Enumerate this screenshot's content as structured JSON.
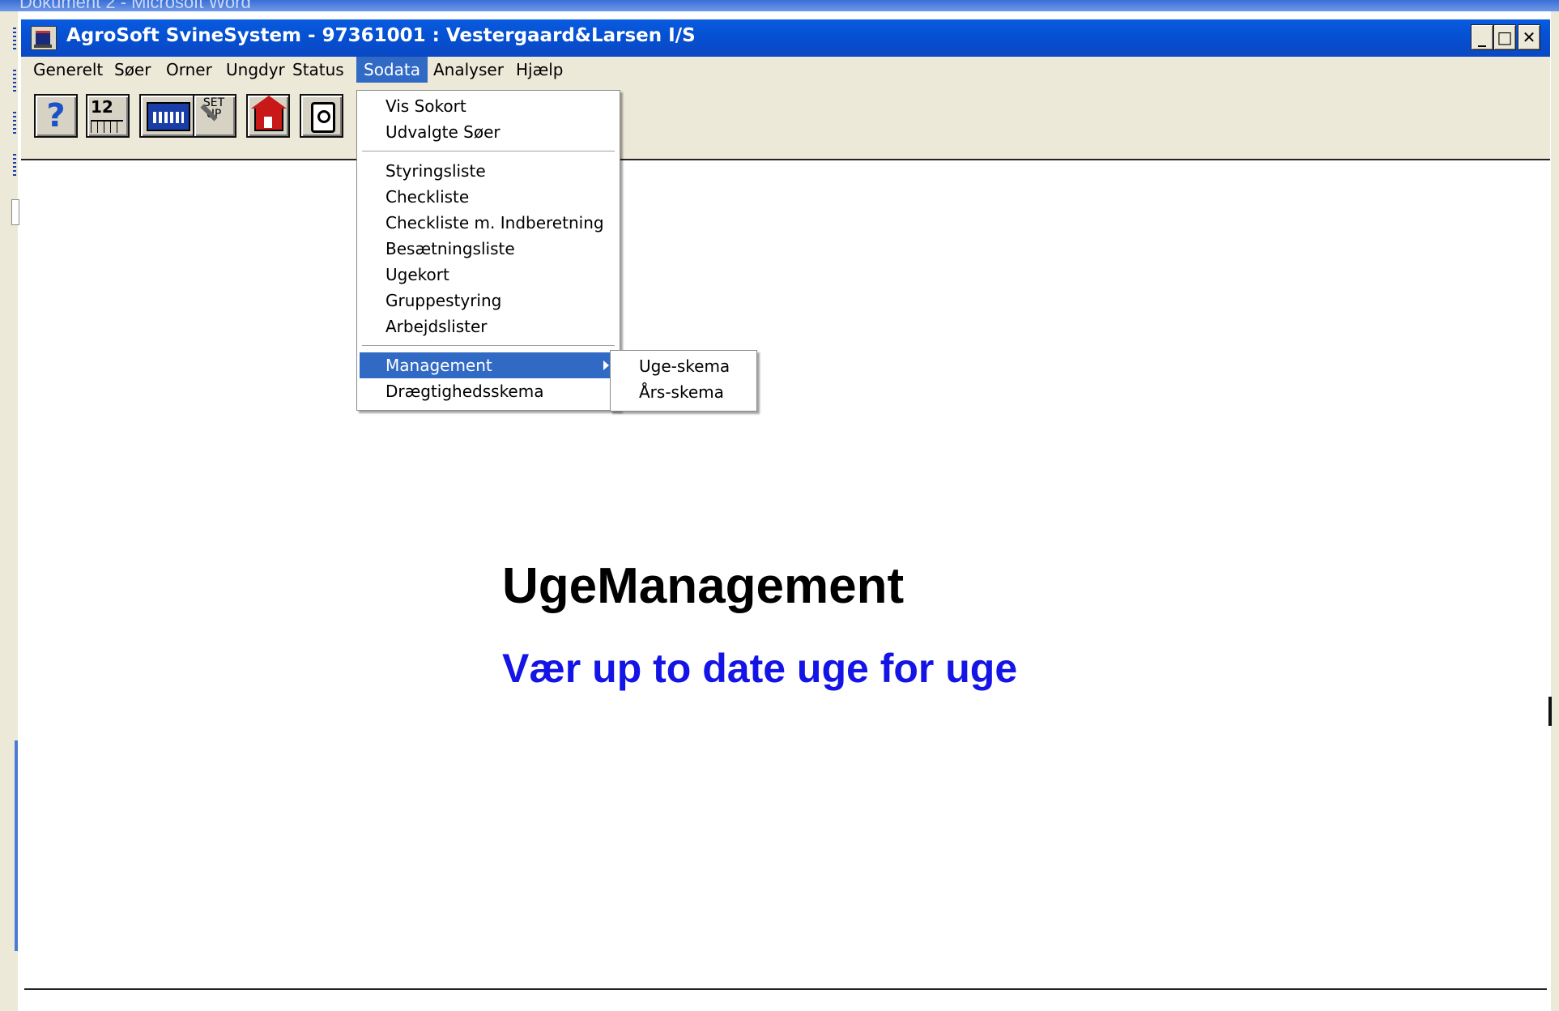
{
  "background_window": {
    "title": "Dokument 2 - Microsoft Word"
  },
  "window": {
    "title": "AgroSoft SvineSystem - 97361001 : Vestergaard&Larsen I/S",
    "minimize_glyph": "_",
    "maximize_glyph": "□",
    "close_glyph": "✕"
  },
  "menubar": {
    "items": [
      {
        "label": "Generelt"
      },
      {
        "label": "Søer"
      },
      {
        "label": "Orner"
      },
      {
        "label": "Ungdyr"
      },
      {
        "label": "Status"
      },
      {
        "label": "Sodata",
        "active": true
      },
      {
        "label": "Analyser"
      },
      {
        "label": "Hjælp"
      }
    ]
  },
  "toolbar": {
    "help_glyph": "?",
    "calendar_number": "12",
    "setup_label": "SET UP",
    "icons": [
      "help-icon",
      "calendar-icon",
      "calculator-icon",
      "setup-icon",
      "home-icon",
      "exit-icon"
    ]
  },
  "dropdown": {
    "group1": [
      "Vis Sokort",
      "Udvalgte Søer"
    ],
    "group2": [
      "Styringsliste",
      "Checkliste",
      "Checkliste m. Indberetning",
      "Besætningsliste",
      "Ugekort",
      "Gruppestyring",
      "Arbejdslister"
    ],
    "group3": [
      "Management",
      "Drægtighedsskema"
    ],
    "highlighted": "Management"
  },
  "submenu": {
    "items": [
      "Uge-skema",
      "Års-skema"
    ]
  },
  "slide": {
    "heading": "UgeManagement",
    "subheading": "Vær up to date uge for uge"
  },
  "colors": {
    "titlebar": "#0551d4",
    "highlight": "#316ac5",
    "subheading": "#1414e6",
    "chrome": "#ece9d8"
  }
}
